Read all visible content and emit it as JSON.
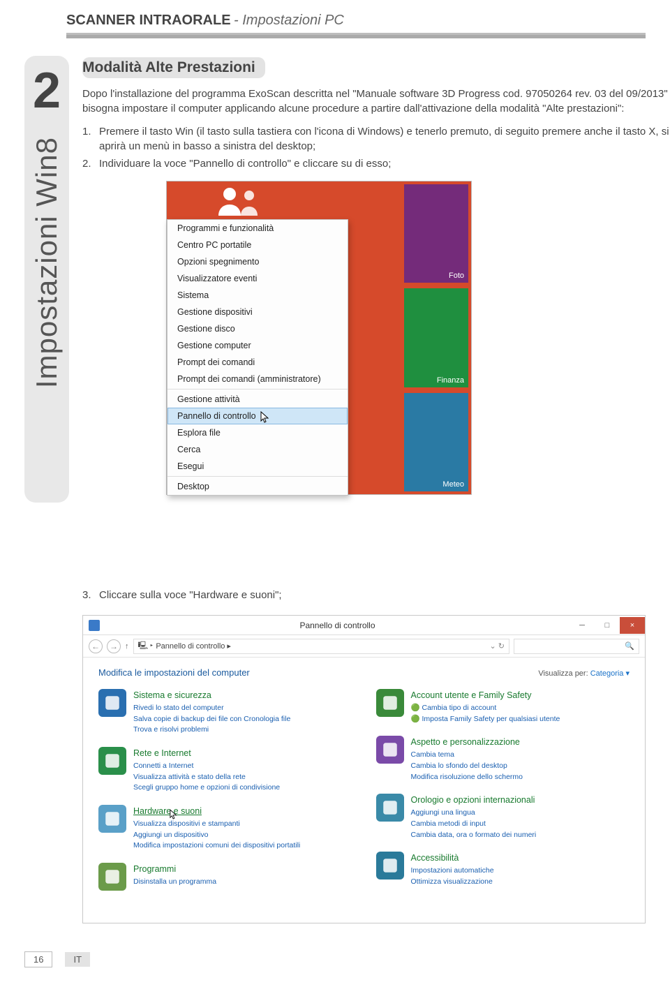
{
  "header": {
    "title": "SCANNER INTRAORALE",
    "sub": " - Impostazioni PC"
  },
  "sidebar": {
    "number": "2",
    "label": "Impostazioni Win8"
  },
  "section_heading": "Modalità Alte Prestazioni",
  "intro": "Dopo l'installazione del programma ExoScan descritta nel \"Manuale software 3D Progress cod. 97050264 rev. 03 del 09/2013\" bisogna impostare il computer applicando alcune procedure a partire dall'attivazione della modalità \"Alte prestazioni\":",
  "steps12": [
    {
      "n": "1.",
      "text": "Premere il tasto Win (il tasto sulla tastiera con l'icona di Windows) e tenerlo premuto, di seguito premere anche il tasto X, si aprirà un menù in basso a sinistra del desktop;"
    },
    {
      "n": "2.",
      "text": "Individuare la voce \"Pannello di controllo\" e cliccare su di esso;"
    }
  ],
  "winx_menu": {
    "group1": [
      "Programmi e funzionalità",
      "Centro PC portatile",
      "Opzioni spegnimento",
      "Visualizzatore eventi",
      "Sistema",
      "Gestione dispositivi",
      "Gestione disco",
      "Gestione computer",
      "Prompt dei comandi",
      "Prompt dei comandi (amministratore)"
    ],
    "group2_a": "Gestione attività",
    "highlight": "Pannello di controllo",
    "group2_b": [
      "Esplora file",
      "Cerca",
      "Esegui"
    ],
    "group3": "Desktop"
  },
  "tiles": {
    "foto": "Foto",
    "finanza": "Finanza",
    "meteo": "Meteo"
  },
  "step3": {
    "n": "3.",
    "text": "Cliccare sulla voce \"Hardware e suoni\";"
  },
  "cp": {
    "title": "Pannello di controllo",
    "breadcrumb": "Pannello di controllo ▸",
    "search_placeholder": "",
    "body_title": "Modifica le impostazioni del computer",
    "view_label": "Visualizza per:",
    "view_value": "Categoria ▾",
    "left": [
      {
        "title": "Sistema e sicurezza",
        "subs": [
          "Rivedi lo stato del computer",
          "Salva copie di backup dei file con Cronologia file",
          "Trova e risolvi problemi"
        ],
        "icon": "#2a6fb0"
      },
      {
        "title": "Rete e Internet",
        "subs": [
          "Connetti a Internet",
          "Visualizza attività e stato della rete",
          "Scegli gruppo home e opzioni di condivisione"
        ],
        "icon": "#2a8f4a"
      },
      {
        "title": "Hardware e suoni",
        "hover": true,
        "subs": [
          "Visualizza dispositivi e stampanti",
          "Aggiungi un dispositivo",
          "Modifica impostazioni comuni dei dispositivi portatili"
        ],
        "icon": "#5aa0c8"
      },
      {
        "title": "Programmi",
        "subs": [
          "Disinstalla un programma"
        ],
        "icon": "#6b9b4a"
      }
    ],
    "right": [
      {
        "title": "Account utente e Family Safety",
        "subs": [
          "🟢 Cambia tipo di account",
          "🟢 Imposta Family Safety per qualsiasi utente"
        ],
        "icon": "#3a8a3a"
      },
      {
        "title": "Aspetto e personalizzazione",
        "subs": [
          "Cambia tema",
          "Cambia lo sfondo del desktop",
          "Modifica risoluzione dello schermo"
        ],
        "icon": "#7a4aa8"
      },
      {
        "title": "Orologio e opzioni internazionali",
        "subs": [
          "Aggiungi una lingua",
          "Cambia metodi di input",
          "Cambia data, ora o formato dei numeri"
        ],
        "icon": "#3a8aa8"
      },
      {
        "title": "Accessibilità",
        "subs": [
          "Impostazioni automatiche",
          "Ottimizza visualizzazione"
        ],
        "icon": "#2a7a9a"
      }
    ]
  },
  "footer": {
    "page": "16",
    "lang": "IT"
  }
}
